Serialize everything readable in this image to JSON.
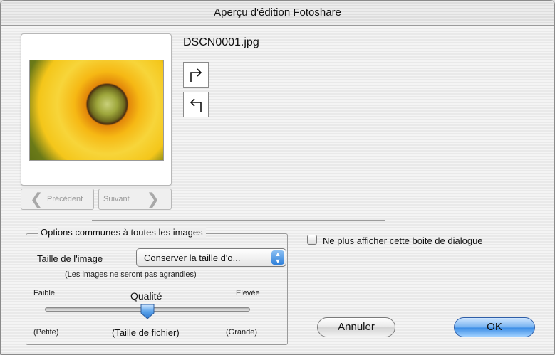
{
  "window": {
    "title": "Aperçu d'édition Fotoshare"
  },
  "preview": {
    "filename": "DSCN0001.jpg",
    "prev_label": "Précédent",
    "next_label": "Suivant"
  },
  "options": {
    "group_title": "Options communes à toutes les images",
    "size_label": "Taille de l'image",
    "size_value": "Conserver la taille d'o...",
    "size_note": "(Les images ne seront pas agrandies)",
    "quality": {
      "title": "Qualité",
      "low_label": "Faible",
      "high_label": "Elevée",
      "small_label": "(Petite)",
      "filesize_label": "(Taille de fichier)",
      "large_label": "(Grande)",
      "level": 0.5
    }
  },
  "dont_show_label": "Ne plus afficher cette boite de dialogue",
  "dont_show_checked": false,
  "buttons": {
    "cancel": "Annuler",
    "ok": "OK"
  },
  "icons": {
    "rotate_right": "rotate-right-icon",
    "rotate_left": "rotate-left-icon",
    "prev": "chevron-left-icon",
    "next": "chevron-right-icon",
    "popup": "up-down-arrows-icon"
  },
  "colors": {
    "default_button": "#3f8fe6"
  }
}
